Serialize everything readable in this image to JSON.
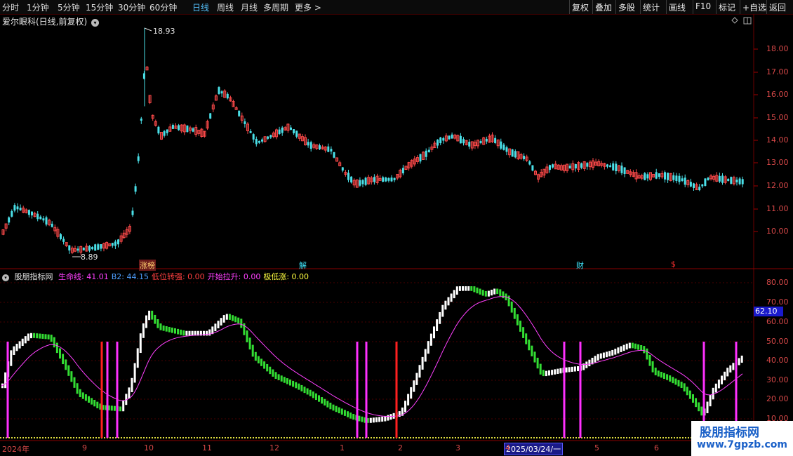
{
  "toolbar": {
    "periods": [
      "分时",
      "1分钟",
      "5分钟",
      "15分钟",
      "30分钟",
      "60分钟",
      "日线",
      "周线",
      "月线",
      "多周期",
      "更多 >"
    ],
    "active_period": "日线",
    "tools": [
      "复权",
      "叠加",
      "多股",
      "统计",
      "画线",
      "F10",
      "标记",
      "+自选",
      "返回"
    ]
  },
  "stock": {
    "title": "爱尔眼科(日线,前复权)"
  },
  "price_axis": [
    "18.00",
    "17.00",
    "16.00",
    "15.00",
    "14.00",
    "13.00",
    "12.00",
    "11.00",
    "10.00"
  ],
  "annotations": {
    "high": "18.93",
    "low": "8.89"
  },
  "event_markers": [
    {
      "label": "涨榜",
      "color": "#ffd070"
    },
    {
      "label": "解",
      "color": "#40e8ff"
    },
    {
      "label": "财",
      "color": "#40e8ff"
    },
    {
      "label": "$",
      "color": "#ff3030"
    }
  ],
  "indicator": {
    "name": "股朋指标网",
    "items": [
      {
        "label": "生命线: 41.01",
        "color": "#ff40ff"
      },
      {
        "label": "B2: 44.15",
        "color": "#4fa0ff"
      },
      {
        "label": "低位转强: 0.00",
        "color": "#ff4040"
      },
      {
        "label": "开始拉升: 0.00",
        "color": "#ff40ff"
      },
      {
        "label": "极低涨: 0.00",
        "color": "#ffff40"
      }
    ],
    "axis": [
      "80.00",
      "70.00",
      "60.00",
      "50.00",
      "40.00",
      "30.00",
      "20.00",
      "10.00"
    ],
    "current_value": "62.10"
  },
  "dates": [
    "2024年",
    "9",
    "10",
    "11",
    "12",
    "1",
    "2",
    "3",
    "4",
    "5",
    "6"
  ],
  "date_cursor": "2025/03/24/一",
  "watermark": {
    "title": "股朋指标网",
    "url": "www.7gpzb.com"
  },
  "colors": {
    "up": "#ff4a4a",
    "down": "#4ae0e8",
    "grid": "#5a0000",
    "lifeline": "#ff40ff"
  },
  "chart_data": {
    "type": "candlestick",
    "price_range": [
      8.89,
      18.93
    ],
    "indicator_range": [
      10,
      80
    ]
  }
}
